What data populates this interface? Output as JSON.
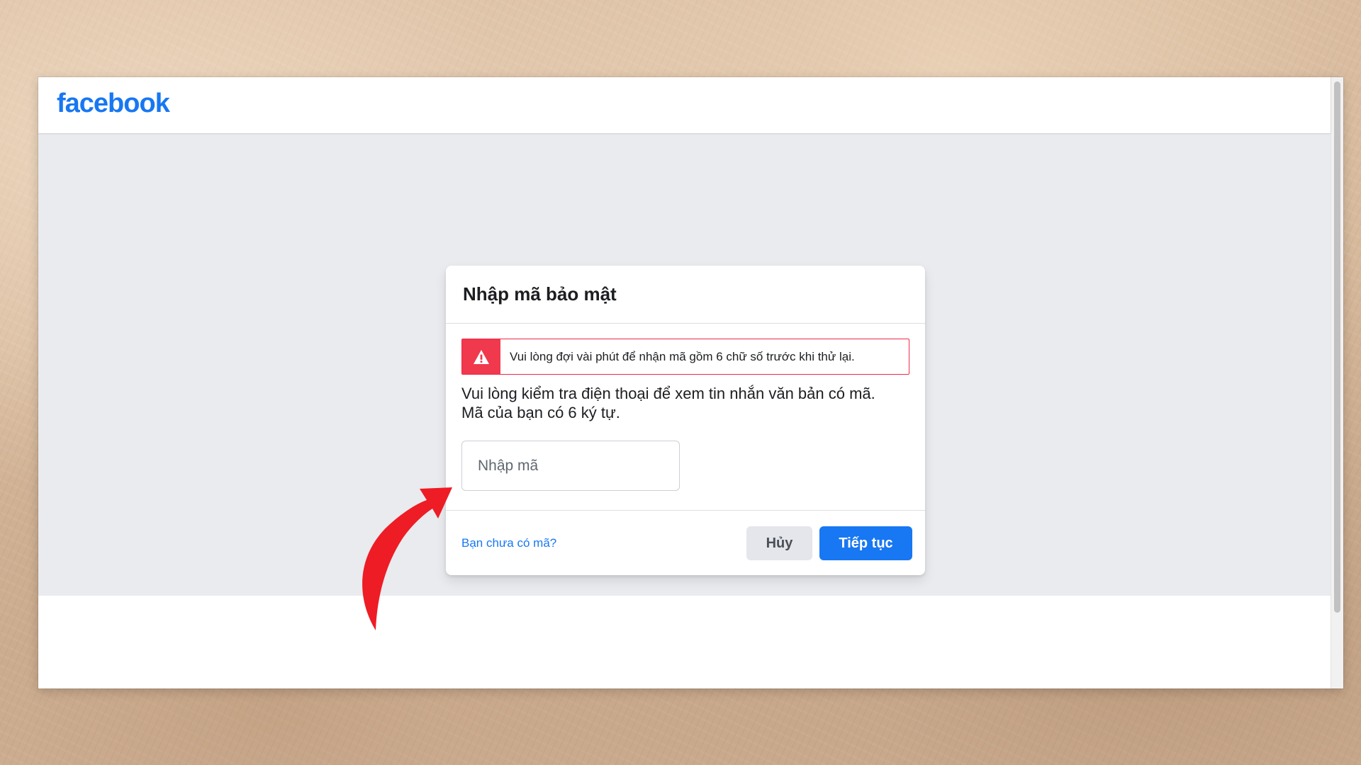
{
  "header": {
    "logo_text": "facebook"
  },
  "dialog": {
    "title": "Nhập mã bảo mật",
    "alert": {
      "icon": "warning-triangle-icon",
      "message": "Vui lòng đợi vài phút để nhận mã gồm 6 chữ số trước khi thử lại."
    },
    "instructions_line1": "Vui lòng kiểm tra điện thoại để xem tin nhắn văn bản có mã.",
    "instructions_line2": "Mã của bạn có 6 ký tự.",
    "code_input": {
      "placeholder": "Nhập mã",
      "value": ""
    },
    "no_code_link": "Bạn chưa có mã?",
    "cancel_label": "Hủy",
    "continue_label": "Tiếp tục"
  },
  "colors": {
    "brand_blue": "#1877f2",
    "alert_red": "#f0394c",
    "page_gray": "#e9ebee",
    "annotation_red": "#ee1c25"
  }
}
